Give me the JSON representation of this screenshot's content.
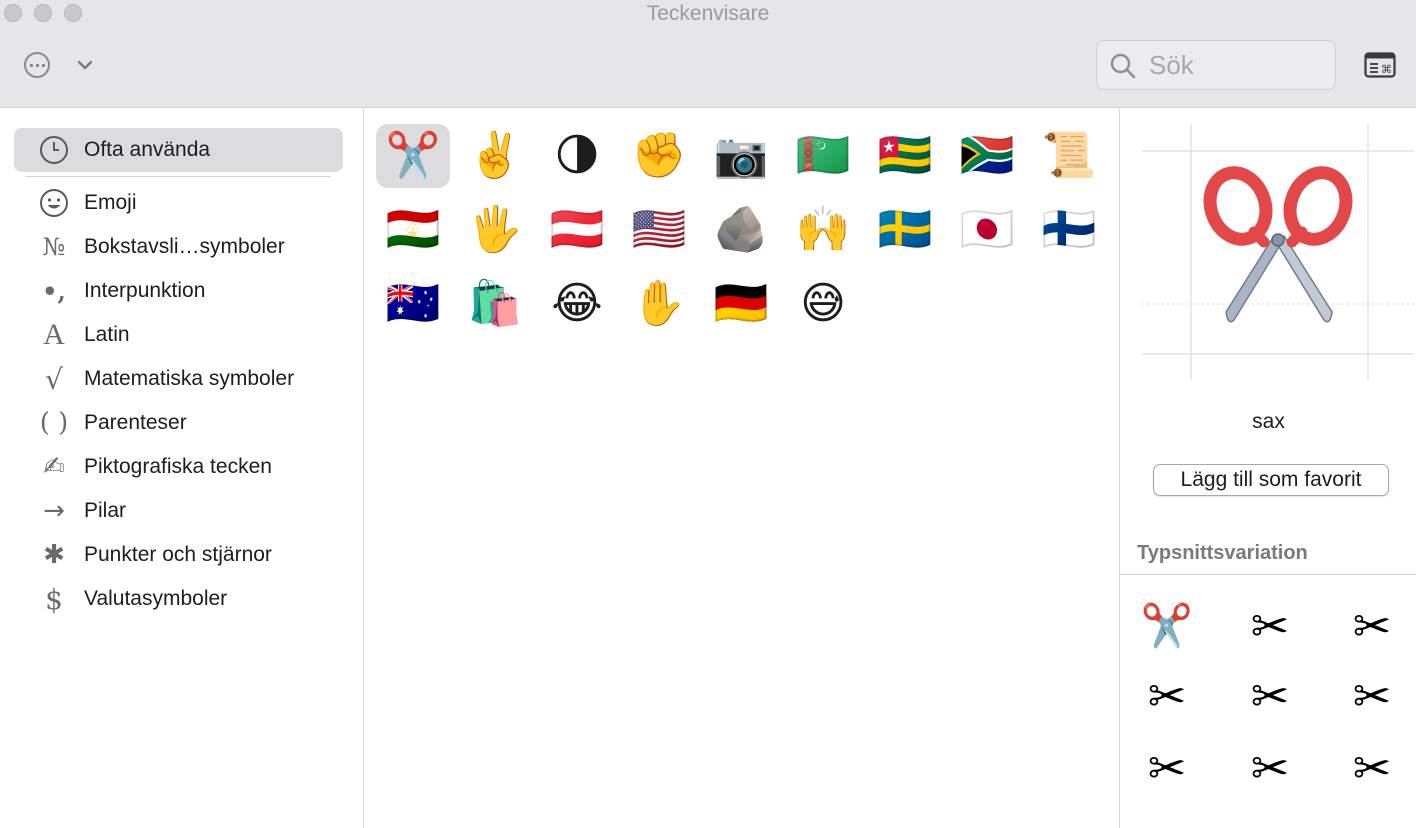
{
  "window": {
    "title": "Teckenvisare"
  },
  "toolbar": {
    "more_icon": "ellipsis-circle-icon",
    "chevron_icon": "chevron-down-icon",
    "search_placeholder": "Sök",
    "search_value": "",
    "keyboard_icon": "keyboard-viewer-icon"
  },
  "sidebar": {
    "items": [
      {
        "label": "Ofta använda",
        "icon": "clock-icon",
        "glyph": "🕘",
        "selected": true
      },
      {
        "label": "Emoji",
        "icon": "smiley-icon",
        "glyph": "☺"
      },
      {
        "label": "Bokstavsli…symboler",
        "icon": "numero-icon",
        "glyph": "№"
      },
      {
        "label": "Interpunktion",
        "icon": "punctuation-icon",
        "glyph": "•,"
      },
      {
        "label": "Latin",
        "icon": "latin-a-icon",
        "glyph": "A"
      },
      {
        "label": "Matematiska symboler",
        "icon": "sqrt-icon",
        "glyph": "√"
      },
      {
        "label": "Parenteser",
        "icon": "parentheses-icon",
        "glyph": "( )"
      },
      {
        "label": "Piktografiska tecken",
        "icon": "writing-hand-icon",
        "glyph": "✍"
      },
      {
        "label": "Pilar",
        "icon": "arrow-right-icon",
        "glyph": "→"
      },
      {
        "label": "Punkter och stjärnor",
        "icon": "asterisk-icon",
        "glyph": "✱"
      },
      {
        "label": "Valutasymboler",
        "icon": "dollar-icon",
        "glyph": "$"
      }
    ]
  },
  "grid": {
    "characters": [
      "✂️",
      "✌️",
      "🌗",
      "✊",
      "📷",
      "🇹🇲",
      "🇹🇬",
      "🇿🇦",
      "📜",
      "🇹🇯",
      "🖐️",
      "🇦🇹",
      "🇺🇸",
      "🪨",
      "🙌",
      "🇸🇪",
      "🇯🇵",
      "🇫🇮",
      "🇦🇺",
      "🛍️",
      "😂",
      "✋",
      "🇩🇪",
      "😅"
    ],
    "selected_index": 0
  },
  "detail": {
    "preview_glyph": "✂️",
    "name": "sax",
    "favorite_button": "Lägg till som favorit",
    "variation_title": "Typsnittsvariation",
    "variations": [
      "✂️",
      "✂",
      "✂",
      "✂",
      "✂",
      "✂",
      "✂",
      "✂",
      "✂"
    ],
    "colors": {
      "blade": "#aab4c4",
      "handle": "#e24848"
    }
  }
}
